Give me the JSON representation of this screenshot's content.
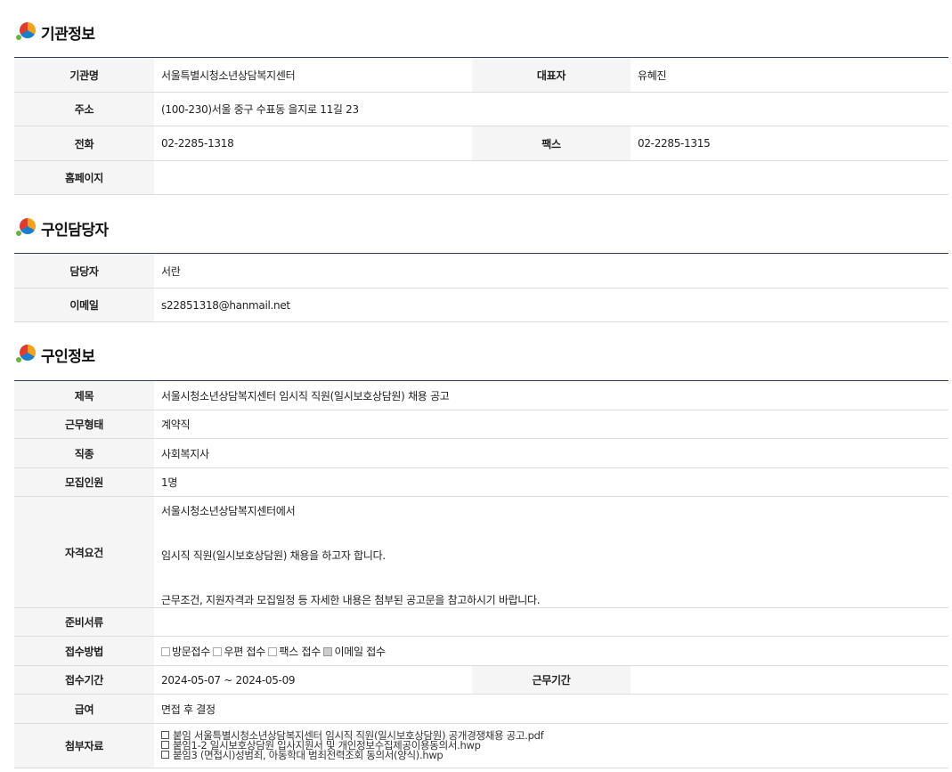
{
  "sections": {
    "org": {
      "title": "기관정보"
    },
    "contact": {
      "title": "구인담당자"
    },
    "job": {
      "title": "구인정보"
    }
  },
  "org": {
    "name_label": "기관명",
    "name": "서울특별시청소년상담복지센터",
    "rep_label": "대표자",
    "rep": "유혜진",
    "addr_label": "주소",
    "addr": "(100-230)서울 중구 수표동 을지로 11길 23",
    "tel_label": "전화",
    "tel": "02-2285-1318",
    "fax_label": "팩스",
    "fax": "02-2285-1315",
    "home_label": "홈페이지",
    "home": ""
  },
  "contact": {
    "person_label": "담당자",
    "person": "서란",
    "email_label": "이메일",
    "email": "s22851318@hanmail.net"
  },
  "job": {
    "title_label": "제목",
    "title": "서울시청소년상담복지센터 임시직 직원(일시보호상담원) 채용 공고",
    "type_label": "근무형태",
    "type": "계약직",
    "kind_label": "직종",
    "kind": "사회복지사",
    "count_label": "모집인원",
    "count": "1명",
    "qual_label": "자격요건",
    "qual_lines": [
      "서울시청소년상담복지센터에서",
      "임시직 직원(일시보호상담원) 채용을 하고자 합니다.",
      "근무조건, 지원자격과 모집일정 등 자세한 내용은 첨부된 공고문을 참고하시기 바랍니다."
    ],
    "docs_label": "준비서류",
    "docs": "",
    "method_label": "접수방법",
    "methods": [
      {
        "label": "방문접수",
        "checked": false
      },
      {
        "label": "우편 접수",
        "checked": false
      },
      {
        "label": "팩스 접수",
        "checked": false
      },
      {
        "label": "이메일 접수",
        "checked": true
      }
    ],
    "period_label": "접수기간",
    "period": "2024-05-07 ~ 2024-05-09",
    "workterm_label": "근무기간",
    "workterm": "",
    "salary_label": "급여",
    "salary": "면접 후 결정",
    "attach_label": "첨부자료",
    "attachments": [
      "붙임 서울특별시청소년상담복지센터 임시직 직원(일시보호상담원) 공개경쟁채용 공고.pdf",
      "붙임1-2 일시보호상담원 입사지원서 및 개인정보수집제공이용동의서.hwp",
      "붙임3 (면접시)성범죄, 아동학대 범죄전력조회 동의서(양식).hwp"
    ]
  }
}
